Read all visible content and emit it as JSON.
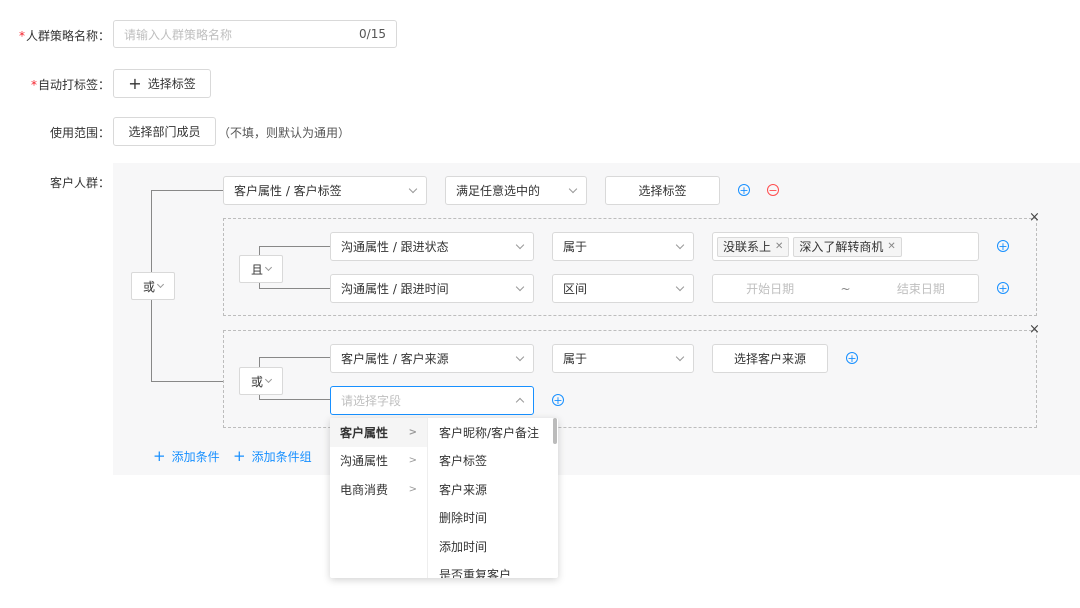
{
  "form": {
    "name_label": "人群策略名称：",
    "name_placeholder": "请输入人群策略名称",
    "name_count": "0/15",
    "autotag_label": "自动打标签：",
    "autotag_button": "选择标签",
    "scope_label": "使用范围：",
    "scope_button": "选择部门成员",
    "scope_hint": "（不填，则默认为通用）",
    "crowd_label": "客户人群：",
    "required_mark": "*"
  },
  "root": {
    "logic": "或",
    "row1": {
      "field": "客户属性 / 客户标签",
      "operator": "满足任意选中的",
      "value_button": "选择标签"
    }
  },
  "group1": {
    "logic": "且",
    "row1": {
      "field": "沟通属性 / 跟进状态",
      "operator": "属于",
      "tags": [
        "没联系上",
        "深入了解转商机"
      ]
    },
    "row2": {
      "field": "沟通属性 / 跟进时间",
      "operator": "区间",
      "start_placeholder": "开始日期",
      "separator": "~",
      "end_placeholder": "结束日期"
    }
  },
  "group2": {
    "logic": "或",
    "row1": {
      "field": "客户属性 / 客户来源",
      "operator": "属于",
      "value_button": "选择客户来源"
    },
    "row2": {
      "field_placeholder": "请选择字段"
    }
  },
  "actions": {
    "add_condition": "添加条件",
    "add_group": "添加条件组"
  },
  "dropdown": {
    "categories": [
      "客户属性",
      "沟通属性",
      "电商消费"
    ],
    "fields": [
      "客户昵称/客户备注",
      "客户标签",
      "客户来源",
      "删除时间",
      "添加时间",
      "是否重复客户"
    ]
  },
  "colors": {
    "primary": "#1890ff",
    "danger": "#ff4d4f",
    "required": "#f5222d"
  }
}
